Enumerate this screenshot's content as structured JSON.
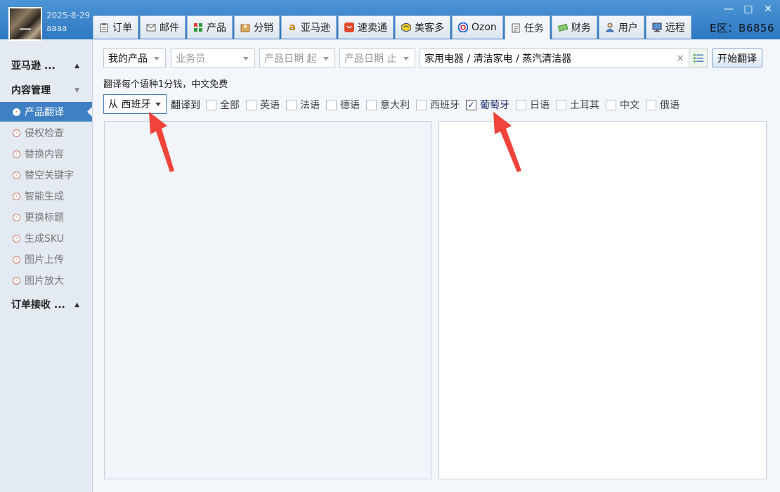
{
  "header": {
    "date": "2025-8-29",
    "user": "aaaa",
    "region": "E区：B6856",
    "window_controls": [
      "—",
      "□",
      "✕"
    ],
    "tabs": [
      {
        "label": "订单",
        "icon": "clipboard-icon"
      },
      {
        "label": "邮件",
        "icon": "mail-icon"
      },
      {
        "label": "产品",
        "icon": "grid-icon"
      },
      {
        "label": "分销",
        "icon": "box-icon"
      },
      {
        "label": "亚马逊",
        "icon": "amazon-icon"
      },
      {
        "label": "速卖通",
        "icon": "aliexpress-icon"
      },
      {
        "label": "美客多",
        "icon": "mercado-icon"
      },
      {
        "label": "Ozon",
        "icon": "ozon-icon"
      },
      {
        "label": "任务",
        "icon": "task-icon"
      },
      {
        "label": "财务",
        "icon": "money-icon"
      },
      {
        "label": "用户",
        "icon": "user-icon"
      },
      {
        "label": "远程",
        "icon": "remote-icon"
      }
    ],
    "active_tab": "任务"
  },
  "sidebar": {
    "groups": [
      {
        "label": "亚马逊 ...",
        "caret": "▲"
      },
      {
        "label": "内容管理",
        "caret": "▼"
      },
      {
        "label": "订单接收 ...",
        "caret": "▲"
      }
    ],
    "items": [
      {
        "label": "产品翻译",
        "active": true
      },
      {
        "label": "侵权检查"
      },
      {
        "label": "替换内容"
      },
      {
        "label": "替空关键字"
      },
      {
        "label": "智能生成"
      },
      {
        "label": "更换标题"
      },
      {
        "label": "生成SKU"
      },
      {
        "label": "图片上传"
      },
      {
        "label": "图片放大"
      }
    ]
  },
  "filters": {
    "my_products": "我的产品",
    "salesperson": "业务员",
    "date_start": "产品日期 起",
    "date_end": "产品日期 止",
    "category": "家用电器 / 清洁家电 / 蒸汽清洁器",
    "clear": "×",
    "start_button": "开始翻译"
  },
  "translate": {
    "note": "翻译每个语种1分钱，中文免费",
    "from": "从 西班牙",
    "to_label": "翻译到",
    "languages": [
      {
        "label": "全部",
        "checked": false
      },
      {
        "label": "英语",
        "checked": false
      },
      {
        "label": "法语",
        "checked": false
      },
      {
        "label": "德语",
        "checked": false
      },
      {
        "label": "意大利",
        "checked": false
      },
      {
        "label": "西班牙",
        "checked": false
      },
      {
        "label": "葡萄牙",
        "checked": true
      },
      {
        "label": "日语",
        "checked": false
      },
      {
        "label": "土耳其",
        "checked": false
      },
      {
        "label": "中文",
        "checked": false
      },
      {
        "label": "俄语",
        "checked": false
      }
    ]
  },
  "colors": {
    "titlebar": "#2e78c3",
    "accent": "#3f80c4",
    "annotation_arrow": "#f0443a"
  }
}
